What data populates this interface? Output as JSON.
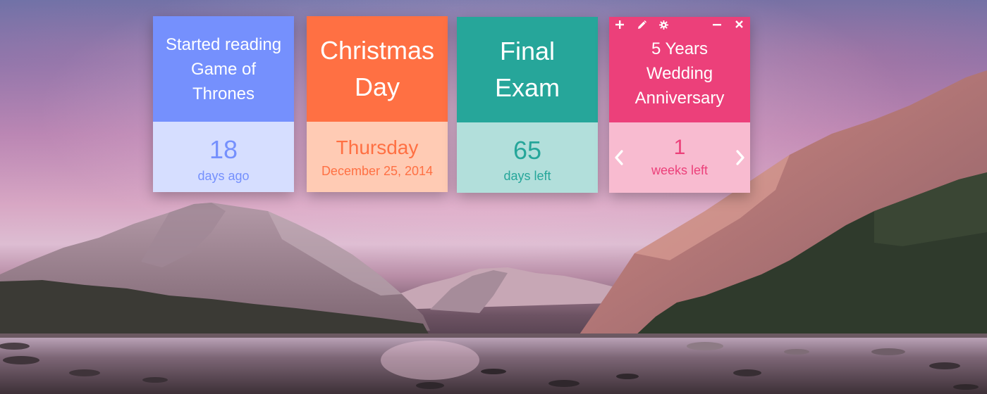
{
  "widgets": [
    {
      "title": "Started reading Game of Thrones",
      "value": "18",
      "label": "days ago"
    },
    {
      "title": "Christmas Day",
      "day_name": "Thursday",
      "date": "December 25, 2014"
    },
    {
      "title": "Final Exam",
      "value": "65",
      "label": "days left"
    },
    {
      "title": "5 Years Wedding Anniversary",
      "value": "1",
      "label": "weeks left",
      "toolbar": [
        "add-icon",
        "edit-icon",
        "settings-icon",
        "minimize-icon",
        "close-icon"
      ],
      "nav": [
        "previous-arrow-icon",
        "next-arrow-icon"
      ]
    }
  ],
  "colors": {
    "blue": "#7590fd",
    "orange": "#ff7043",
    "teal": "#26a69a",
    "pink": "#ec407a"
  }
}
